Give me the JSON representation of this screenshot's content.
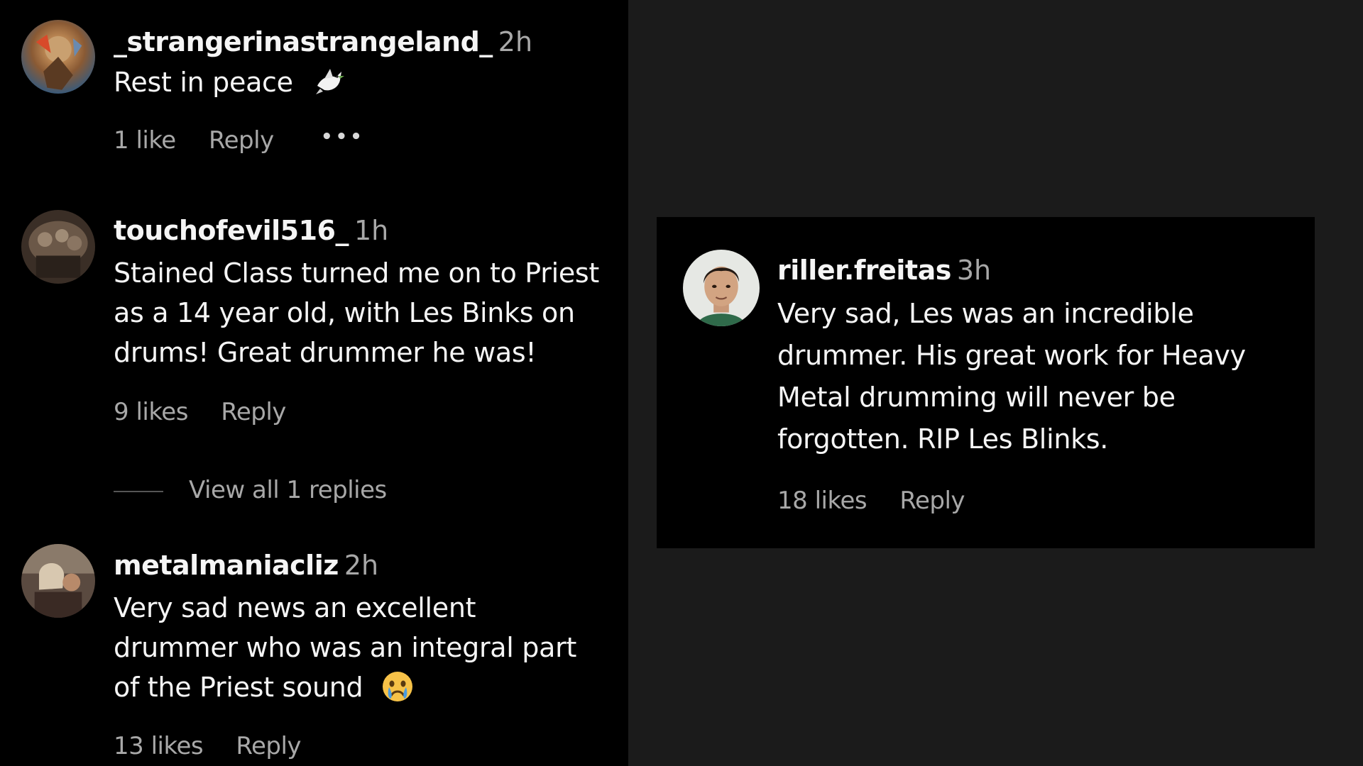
{
  "comments_left": [
    {
      "username": "_strangerinastrangeland_",
      "time": "2h",
      "lines": [
        "Rest in peace"
      ],
      "emoji": "dove-icon",
      "likes": "1 like",
      "reply": "Reply",
      "more": "•••"
    },
    {
      "username": "touchofevil516_",
      "time": "1h",
      "lines": [
        "Stained Class turned me on to Priest",
        "as a 14 year old, with Les Binks on",
        "drums! Great drummer he was!"
      ],
      "likes": "9 likes",
      "reply": "Reply",
      "view_replies": "View all 1 replies"
    },
    {
      "username": "metalmaniacliz",
      "time": "2h",
      "lines": [
        "Very sad news an excellent",
        "drummer who was an integral part",
        "of the Priest sound"
      ],
      "emoji": "crying-face-icon",
      "likes": "13 likes",
      "reply": "Reply"
    }
  ],
  "comment_right": {
    "username": "riller.freitas",
    "time": "3h",
    "lines": [
      "Very sad, Les was an incredible",
      "drummer. His great work for Heavy",
      "Metal drumming will never be",
      "forgotten. RIP Les Blinks."
    ],
    "likes": "18 likes",
    "reply": "Reply"
  },
  "colors": {
    "background_dark": "#000000",
    "background_gap": "#1b1b1b",
    "text_primary": "#f5f5f5",
    "text_secondary": "#a8a8a8"
  }
}
